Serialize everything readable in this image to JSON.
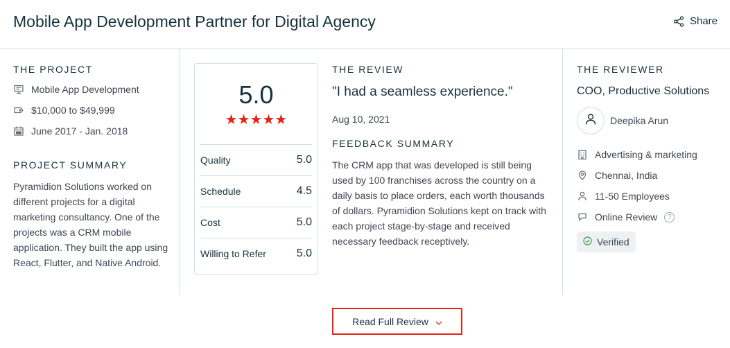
{
  "header": {
    "title": "Mobile App Development Partner for Digital Agency",
    "share_label": "Share"
  },
  "project": {
    "heading": "THE PROJECT",
    "service": "Mobile App Development",
    "budget": "$10,000 to $49,999",
    "timeline": "June 2017 - Jan. 2018"
  },
  "project_summary": {
    "heading": "PROJECT SUMMARY",
    "text": "Pyramidion Solutions worked on different projects for a digital marketing consultancy. One of the projects was a CRM mobile application. They built the app using React, Flutter, and Native Android."
  },
  "rating": {
    "overall": "5.0",
    "stars": "★★★★★",
    "star_color": "#e62415",
    "rows": [
      {
        "label": "Quality",
        "value": "5.0"
      },
      {
        "label": "Schedule",
        "value": "4.5"
      },
      {
        "label": "Cost",
        "value": "5.0"
      },
      {
        "label": "Willing to Refer",
        "value": "5.0"
      }
    ]
  },
  "review": {
    "heading": "THE REVIEW",
    "quote": "\"I had a seamless experience.\"",
    "date": "Aug 10, 2021",
    "feedback_heading": "FEEDBACK SUMMARY",
    "feedback_text": "The CRM app that was developed is still being used by 100 franchises across the country on a daily basis to place orders, each worth thousands of dollars. Pyramidion Solutions kept on track with each project stage-by-stage and received necessary feedback receptively."
  },
  "reviewer": {
    "heading": "THE REVIEWER",
    "role": "COO, Productive Solutions",
    "name": "Deepika Arun",
    "industry": "Advertising & marketing",
    "location": "Chennai, India",
    "size": "11-50 Employees",
    "review_type": "Online Review",
    "help_glyph": "?",
    "verified": "Verified"
  },
  "read_full_review": "Read Full Review",
  "colors": {
    "accent": "#e62415",
    "text_dark": "#17313b",
    "verified_green": "#3c9a4d"
  }
}
